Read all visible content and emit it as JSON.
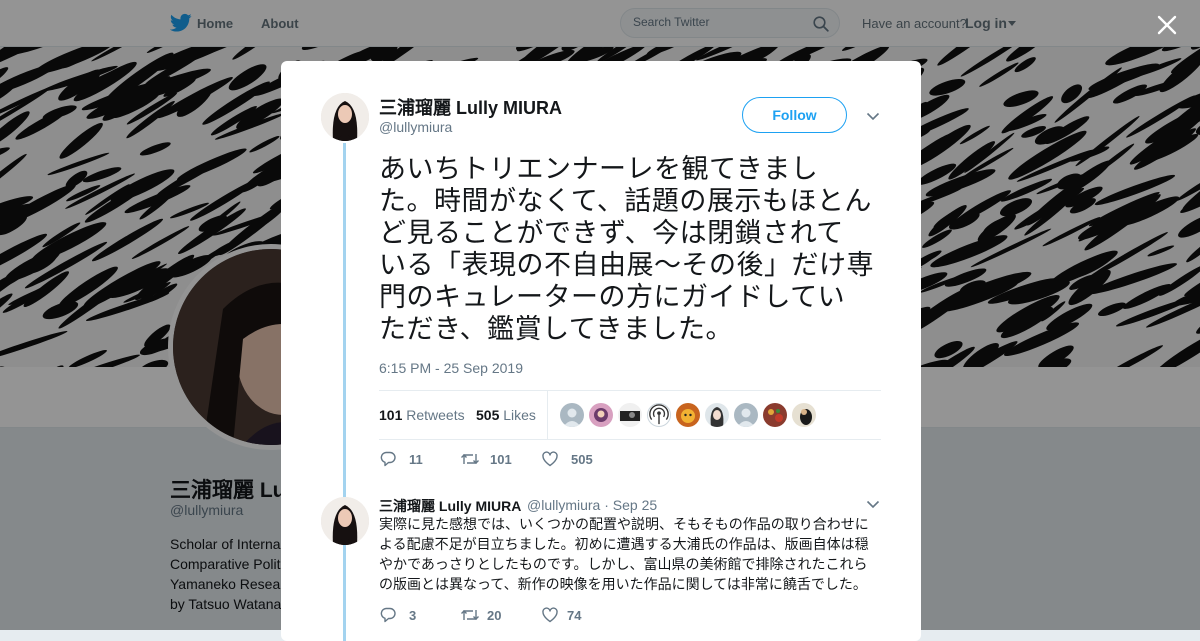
{
  "nav": {
    "home_label": "Home",
    "about_label": "About",
    "search_placeholder": "Search Twitter",
    "have_account": "Have an account?",
    "login_label": "Log in"
  },
  "profile": {
    "name": "三浦瑠麗 Lu",
    "handle": "@lullymiura",
    "bio_lines": [
      "Scholar of Interna",
      "Comparative Polit",
      "Yamaneko Resea",
      "by Tatsuo Watana"
    ]
  },
  "tweet": {
    "author_name": "三浦瑠麗 Lully MIURA",
    "author_handle": "@lullymiura",
    "follow_label": "Follow",
    "text_lines": [
      "あいちトリエンナーレを観てきまし",
      "た。時間がなくて、話題の展示もほとん",
      "ど見ることができず、今は閉鎖されて",
      "いる「表現の不自由展～その後」だけ専",
      "門のキュレーターの方にガイドしてい",
      "ただき、鑑賞してきました。"
    ],
    "timestamp": "6:15 PM - 25 Sep 2019",
    "retweets_count": "101",
    "retweets_label": "Retweets",
    "likes_count": "505",
    "likes_label": "Likes",
    "replies": "11",
    "retweets": "101",
    "likes": "505"
  },
  "reply": {
    "author_name": "三浦瑠麗 Lully MIURA",
    "meta": "@lullymiura · Sep 25",
    "text_lines": [
      "実際に見た感想では、いくつかの配置や説明、そもそもの作品の取り合わせに",
      "よる配慮不足が目立ちました。初めに遭遇する大浦氏の作品は、版画自体は穏",
      "やかであっさりとしたものです。しかし、富山県の美術館で排除されたこれら",
      "の版画とは異なって、新作の映像を用いた作品に関しては非常に饒舌でした。"
    ],
    "replies": "3",
    "retweets": "20",
    "likes": "74"
  },
  "colors": {
    "accent": "#1da1f2",
    "thread_line": "#a3d3ef",
    "text": "#14171a",
    "muted": "#657786"
  }
}
